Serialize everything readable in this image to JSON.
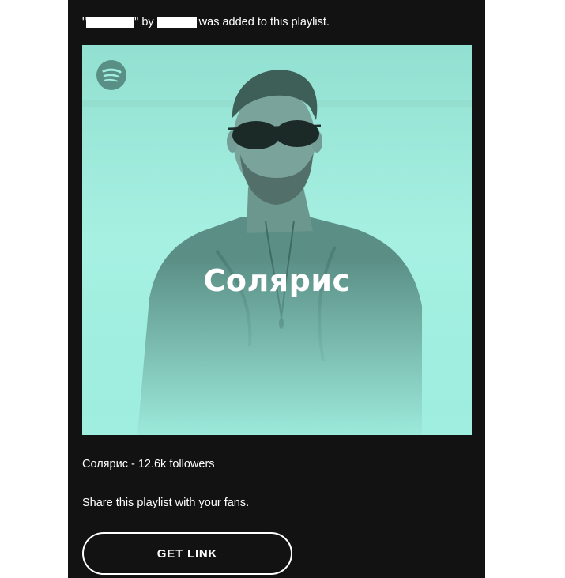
{
  "notice": {
    "quote_open": "\"",
    "quote_close": "\" by",
    "suffix": "was added to this playlist."
  },
  "playlist": {
    "cover_title": "Солярис",
    "meta": "Солярис - 12.6k followers",
    "cover_tint": "#9feedf"
  },
  "share_text": "Share this playlist with your fans.",
  "cta": {
    "label": "GET LINK"
  },
  "icons": {
    "logo": "spotify-logo-icon"
  }
}
